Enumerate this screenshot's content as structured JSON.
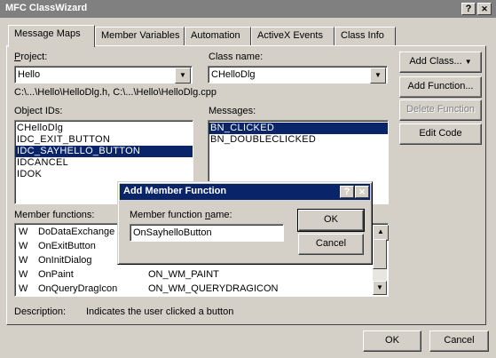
{
  "window": {
    "title": "MFC ClassWizard",
    "help_glyph": "?",
    "close_glyph": "✕"
  },
  "tabs": [
    "Message Maps",
    "Member Variables",
    "Automation",
    "ActiveX Events",
    "Class Info"
  ],
  "project": {
    "label": "Project:",
    "value": "Hello"
  },
  "class_name": {
    "label": "Class name:",
    "value": "CHelloDlg"
  },
  "files": "C:\\...\\Hello\\HelloDlg.h, C:\\...\\Hello\\HelloDlg.cpp",
  "object_ids": {
    "label": "Object IDs:",
    "items": [
      "CHelloDlg",
      "IDC_EXIT_BUTTON",
      "IDC_SAYHELLO_BUTTON",
      "IDCANCEL",
      "IDOK"
    ],
    "selected_index": 2
  },
  "messages": {
    "label": "Messages:",
    "items": [
      "BN_CLICKED",
      "BN_DOUBLECLICKED"
    ],
    "selected_index": 0
  },
  "side_buttons": {
    "add_class": "Add Class...",
    "add_function": "Add Function...",
    "delete_function": "Delete Function",
    "edit_code": "Edit Code"
  },
  "member_functions": {
    "label": "Member functions:",
    "items": [
      {
        "badge": "W",
        "name": "DoDataExchange",
        "map": ""
      },
      {
        "badge": "W",
        "name": "OnExitButton",
        "map": ""
      },
      {
        "badge": "W",
        "name": "OnInitDialog",
        "map": ""
      },
      {
        "badge": "W",
        "name": "OnPaint",
        "map": "ON_WM_PAINT"
      },
      {
        "badge": "W",
        "name": "OnQueryDragIcon",
        "map": "ON_WM_QUERYDRAGICON"
      }
    ]
  },
  "description": {
    "label": "Description:",
    "text": "Indicates the user clicked a button"
  },
  "footer": {
    "ok": "OK",
    "cancel": "Cancel"
  },
  "add_member_dialog": {
    "title": "Add Member Function",
    "help_glyph": "?",
    "close_glyph": "✕",
    "field_label": "Member function name:",
    "field_value": "OnSayhelloButton",
    "ok": "OK",
    "cancel": "Cancel"
  },
  "scroll_glyphs": {
    "up": "▲",
    "down": "▼",
    "combo": "▼"
  }
}
